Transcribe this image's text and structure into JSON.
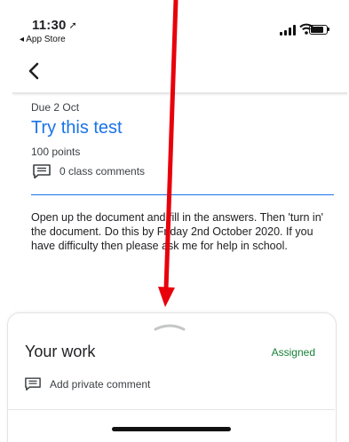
{
  "status_bar": {
    "time": "11:30",
    "back_app": "◂ App Store"
  },
  "assignment": {
    "due": "Due 2 Oct",
    "title": "Try this test",
    "points": "100 points",
    "class_comments": "0 class comments",
    "description": "Open up the document and fill in the answers. Then 'turn in' the document. Do this by Friday 2nd October 2020. If you have difficulty then please ask me for help in school."
  },
  "your_work": {
    "title": "Your work",
    "status": "Assigned",
    "private_comment": "Add private comment"
  },
  "colors": {
    "accent": "#1a73e8",
    "status_green": "#188038",
    "annotation_arrow": "#e8000b"
  }
}
